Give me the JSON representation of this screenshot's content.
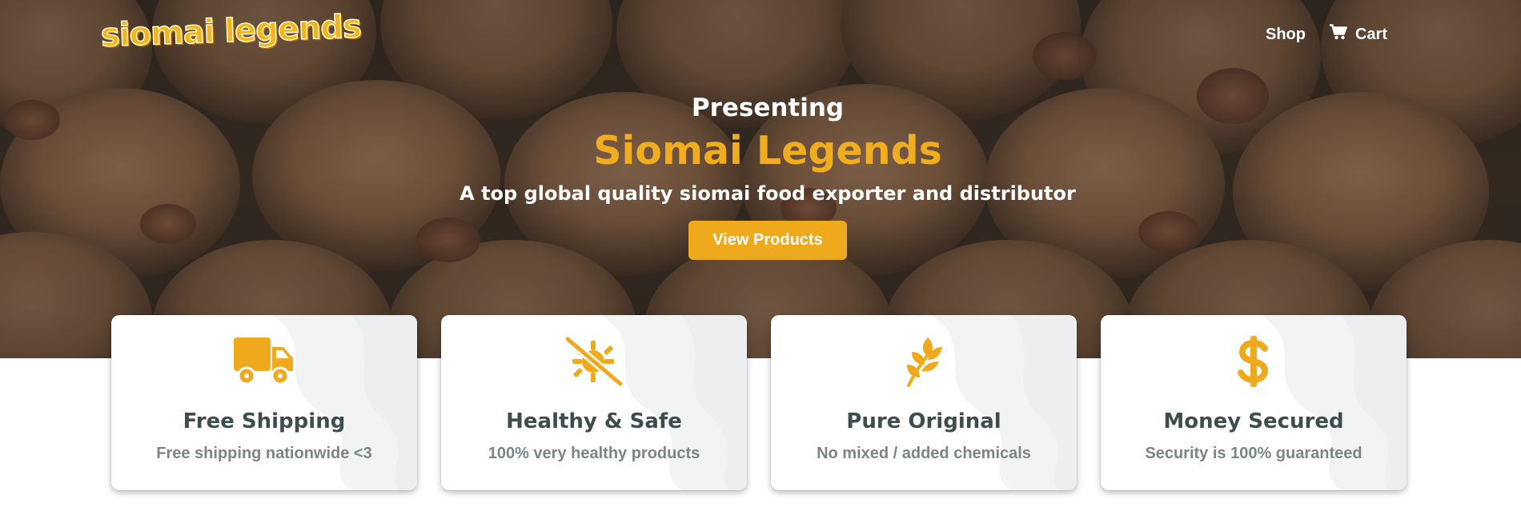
{
  "header": {
    "logo_text": "siomai legends",
    "nav": [
      {
        "label": "Shop",
        "icon": null
      },
      {
        "label": "Cart",
        "icon": "cart-icon"
      }
    ]
  },
  "hero": {
    "kicker": "Presenting",
    "title": "Siomai Legends",
    "tagline": "A top global quality siomai food exporter and distributor",
    "cta_label": "View Products",
    "background": "siomai dumplings photo"
  },
  "features": [
    {
      "icon": "truck-icon",
      "title": "Free Shipping",
      "subtitle": "Free shipping nationwide <3"
    },
    {
      "icon": "no-bacteria-icon",
      "title": "Healthy & Safe",
      "subtitle": "100% very healthy products"
    },
    {
      "icon": "leaf-icon",
      "title": "Pure Original",
      "subtitle": "No mixed / added chemicals"
    },
    {
      "icon": "dollar-icon",
      "title": "Money Secured",
      "subtitle": "Security is 100% guaranteed"
    }
  ],
  "colors": {
    "accent": "#eeaa1c",
    "card_title": "#3d4d4f",
    "card_subtitle": "#7a8587"
  }
}
